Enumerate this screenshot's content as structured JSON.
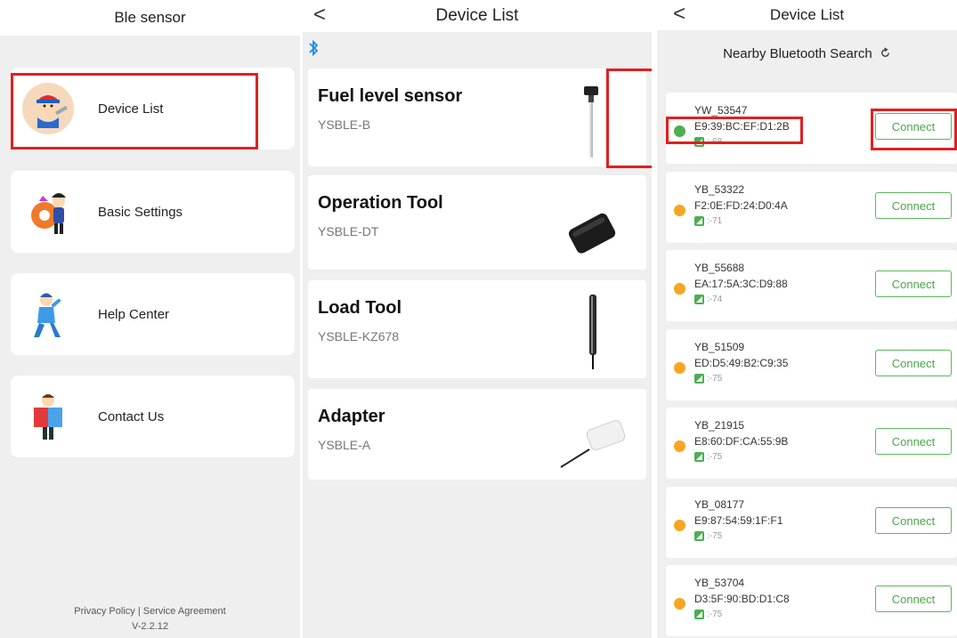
{
  "panel1": {
    "title": "Ble sensor",
    "menu": [
      {
        "label": "Device List",
        "icon": "mechanic-boy-icon"
      },
      {
        "label": "Basic Settings",
        "icon": "gear-person-icon"
      },
      {
        "label": "Help Center",
        "icon": "help-person-icon"
      },
      {
        "label": "Contact Us",
        "icon": "reading-person-icon"
      }
    ],
    "footer": {
      "privacy": "Privacy Policy",
      "sep": "|",
      "agreement": "Service Agreement",
      "version": "V-2.2.12"
    }
  },
  "panel2": {
    "title": "Device List",
    "back": "<",
    "bluetooth_icon": "bluetooth-icon",
    "devices": [
      {
        "name": "Fuel level sensor",
        "model": "YSBLE-B",
        "image": "fuel-probe-image"
      },
      {
        "name": "Operation Tool",
        "model": "YSBLE-DT",
        "image": "black-box-image"
      },
      {
        "name": "Load Tool",
        "model": "YSBLE-KZ678",
        "image": "load-rod-image"
      },
      {
        "name": "Adapter",
        "model": "YSBLE-A",
        "image": "white-adapter-image"
      }
    ]
  },
  "panel3": {
    "title": "Device List",
    "back": "<",
    "search_label": "Nearby Bluetooth Search",
    "refresh_icon": "refresh-icon",
    "connect_label": "Connect",
    "devices": [
      {
        "name": "YW_53547",
        "mac": "E9:39:BC:EF:D1:2B",
        "rssi": ":-68",
        "status_color": "#4caf50"
      },
      {
        "name": "YB_53322",
        "mac": "F2:0E:FD:24:D0:4A",
        "rssi": ":-71",
        "status_color": "#f5a623"
      },
      {
        "name": "YB_55688",
        "mac": "EA:17:5A:3C:D9:88",
        "rssi": ":-74",
        "status_color": "#f5a623"
      },
      {
        "name": "YB_51509",
        "mac": "ED:D5:49:B2:C9:35",
        "rssi": ":-75",
        "status_color": "#f5a623"
      },
      {
        "name": "YB_21915",
        "mac": "E8:60:DF:CA:55:9B",
        "rssi": ":-75",
        "status_color": "#f5a623"
      },
      {
        "name": "YB_08177",
        "mac": "E9:87:54:59:1F:F1",
        "rssi": ":-75",
        "status_color": "#f5a623"
      },
      {
        "name": "YB_53704",
        "mac": "D3:5F:90:BD:D1:C8",
        "rssi": ":-75",
        "status_color": "#f5a623"
      }
    ]
  },
  "colors": {
    "highlight": "#e02020",
    "connect_green": "#5cb85c",
    "bluetooth_blue": "#1e88e5"
  }
}
